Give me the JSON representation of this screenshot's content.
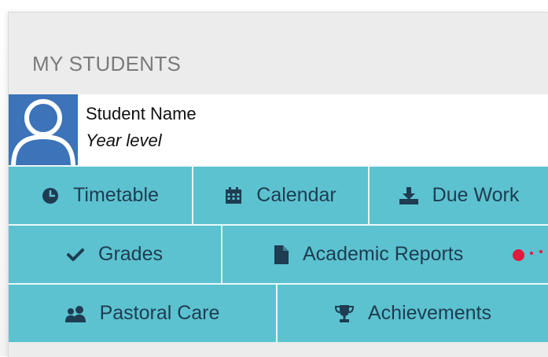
{
  "section": {
    "title": "MY STUDENTS"
  },
  "student": {
    "name": "Student Name",
    "year_level": "Year level",
    "avatar_icon": "user-avatar-icon"
  },
  "menu": {
    "row1": [
      {
        "label": "Timetable",
        "icon": "clock-icon"
      },
      {
        "label": "Calendar",
        "icon": "calendar-icon"
      },
      {
        "label": "Due Work",
        "icon": "download-tray-icon"
      }
    ],
    "row2": [
      {
        "label": "Grades",
        "icon": "checkmark-icon"
      },
      {
        "label": "Academic Reports",
        "icon": "document-icon"
      }
    ],
    "row3": [
      {
        "label": "Pastoral Care",
        "icon": "people-icon"
      },
      {
        "label": "Achievements",
        "icon": "trophy-icon"
      }
    ]
  },
  "colors": {
    "tile": "#5cc2cf",
    "tile_text": "#1e3c52",
    "avatar_bg": "#3c73b9",
    "badge": "#e0193d"
  }
}
